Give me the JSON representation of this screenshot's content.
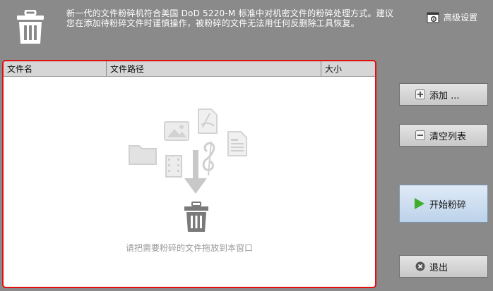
{
  "header": {
    "description": "新一代的文件粉碎机符合美国 DoD 5220-M 标准中对机密文件的粉碎处理方式。建议您在添加待粉碎文件时谨慎操作，被粉碎的文件无法用任何反删除工具恢复。",
    "advanced_settings_label": "高级设置"
  },
  "file_table": {
    "columns": [
      "文件名",
      "文件路径",
      "大小"
    ],
    "rows": [],
    "drop_hint": "请把需要粉碎的文件拖放到本窗口"
  },
  "actions": {
    "add_label": "添加 ...",
    "clear_label": "清空列表",
    "start_label": "开始粉碎",
    "exit_label": "退出"
  },
  "icons": {
    "header": "trash-icon",
    "advanced": "settings-window-icon",
    "add": "plus-icon",
    "clear": "minus-icon",
    "start": "play-icon",
    "exit": "close-circle-icon"
  },
  "colors": {
    "background": "#8a8a8a",
    "panel_border": "#e01010",
    "start_icon": "#3fae2a"
  }
}
